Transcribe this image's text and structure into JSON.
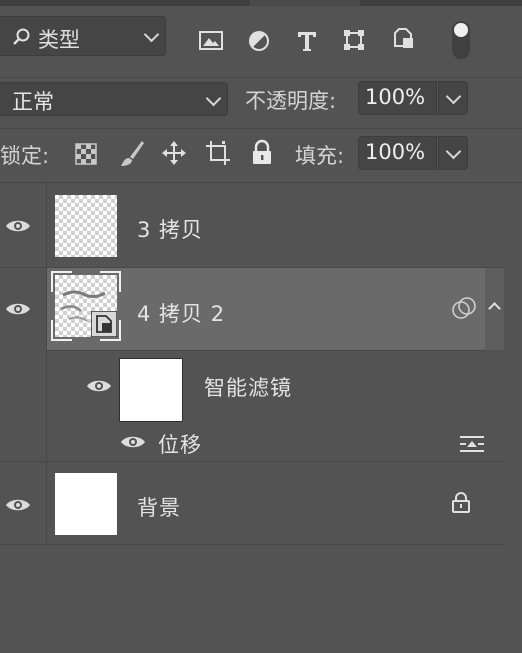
{
  "filter_bar": {
    "kind_label": "类型",
    "icons": [
      "image-filter-icon",
      "adjustment-filter-icon",
      "type-filter-icon",
      "shape-filter-icon",
      "smart-object-filter-icon",
      "filter-toggle-icon"
    ]
  },
  "blend": {
    "mode_label": "正常",
    "opacity_label": "不透明度:",
    "opacity_value": "100%"
  },
  "lock": {
    "label": "锁定:",
    "fill_label": "填充:",
    "fill_value": "100%",
    "icons": [
      "lock-transparent-pixels-icon",
      "lock-image-pixels-icon",
      "lock-position-icon",
      "lock-artboard-icon",
      "lock-all-icon"
    ]
  },
  "layers": [
    {
      "name": "3 拷贝",
      "visible": true,
      "thumb": "checker"
    },
    {
      "name": "4 拷贝 2",
      "visible": true,
      "selected": true,
      "thumb": "smart-object"
    },
    {
      "name": "智能滤镜",
      "visible": true,
      "thumb": "white",
      "indent": 1
    },
    {
      "name": "位移",
      "visible": true,
      "indent": 2
    },
    {
      "name": "背景",
      "visible": true,
      "thumb": "white",
      "locked": true
    }
  ],
  "colors": {
    "panel_bg": "#535353",
    "selected_row": "#6a6a6a",
    "field_bg": "#454545"
  }
}
